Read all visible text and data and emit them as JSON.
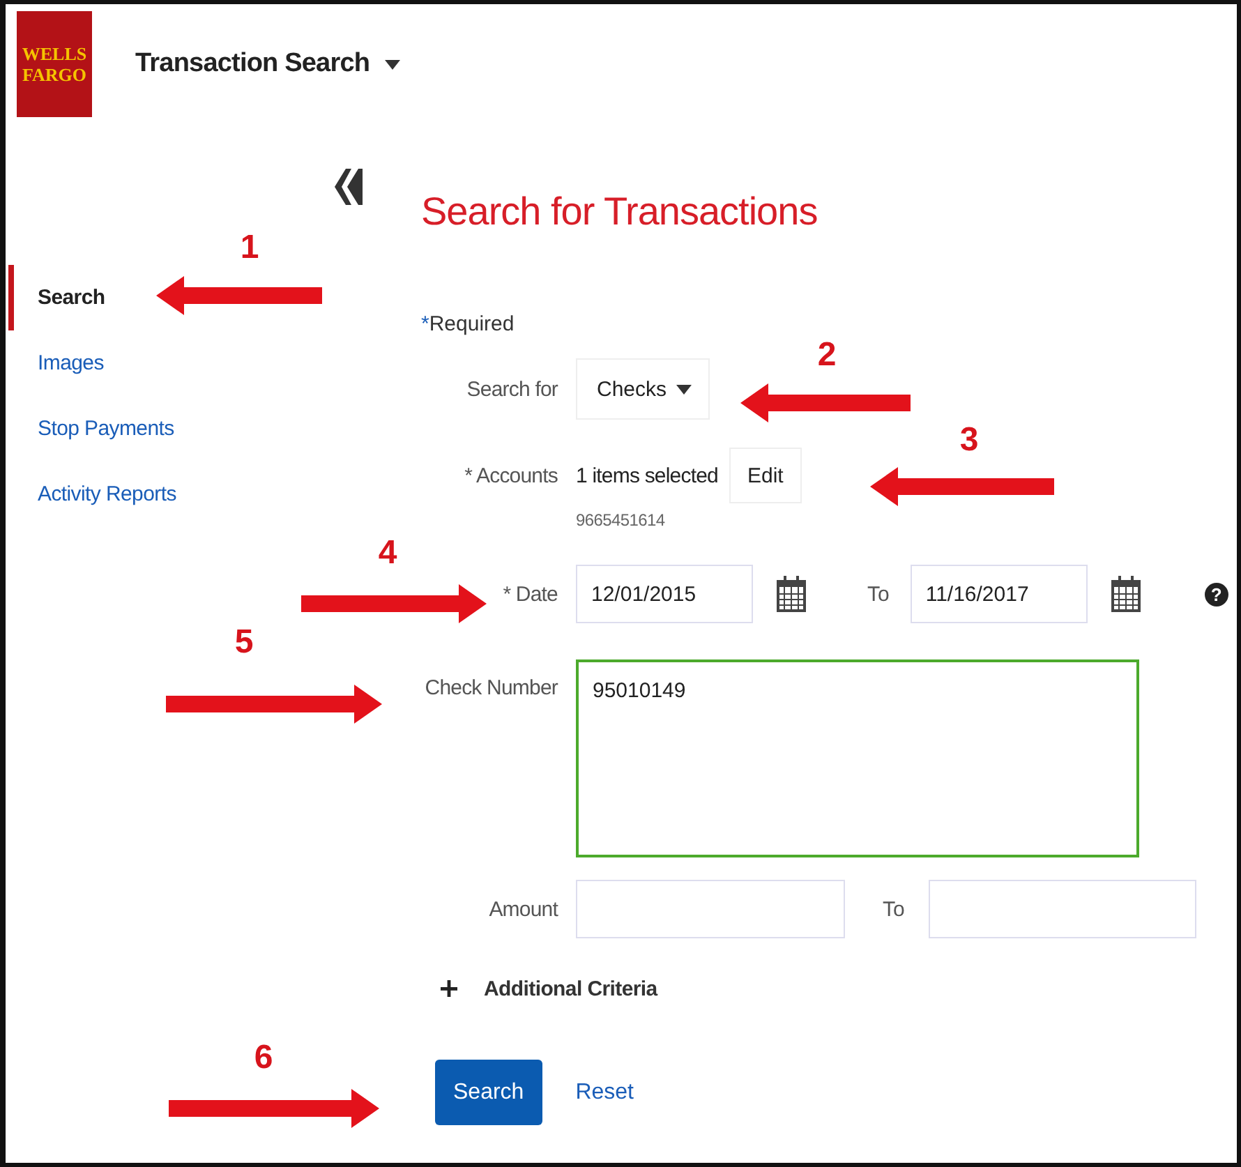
{
  "header": {
    "logo": [
      "WELLS",
      "FARGO"
    ],
    "title": "Transaction Search"
  },
  "sidebar": {
    "items": [
      {
        "label": "Search",
        "selected": true
      },
      {
        "label": "Images",
        "selected": false
      },
      {
        "label": "Stop Payments",
        "selected": false
      },
      {
        "label": "Activity Reports",
        "selected": false
      }
    ]
  },
  "form": {
    "heading": "Search for Transactions",
    "required_note": {
      "marker": "*",
      "text": "Required"
    },
    "search_for": {
      "label": "Search for",
      "value": "Checks"
    },
    "accounts": {
      "label": "* Accounts",
      "summary": "1 items selected",
      "edit_button": "Edit",
      "account_number": "9665451614"
    },
    "date": {
      "label": "* Date",
      "from": "12/01/2015",
      "to_label": "To",
      "to": "11/16/2017",
      "help": "?"
    },
    "check_number": {
      "label": "Check Number",
      "value": "95010149",
      "focused": true
    },
    "amount": {
      "label": "Amount",
      "to_label": "To"
    },
    "additional_criteria": {
      "label": "Additional Criteria",
      "expanded": false
    },
    "buttons": [
      {
        "label": "Search",
        "kind": "primary"
      },
      {
        "label": "Reset",
        "kind": "link"
      }
    ]
  },
  "annotations": [
    {
      "number": "1",
      "kind": "left"
    },
    {
      "number": "2",
      "kind": "left"
    },
    {
      "number": "3",
      "kind": "left"
    },
    {
      "number": "4",
      "kind": "right"
    },
    {
      "number": "5",
      "kind": "right"
    },
    {
      "number": "6",
      "kind": "right"
    }
  ]
}
